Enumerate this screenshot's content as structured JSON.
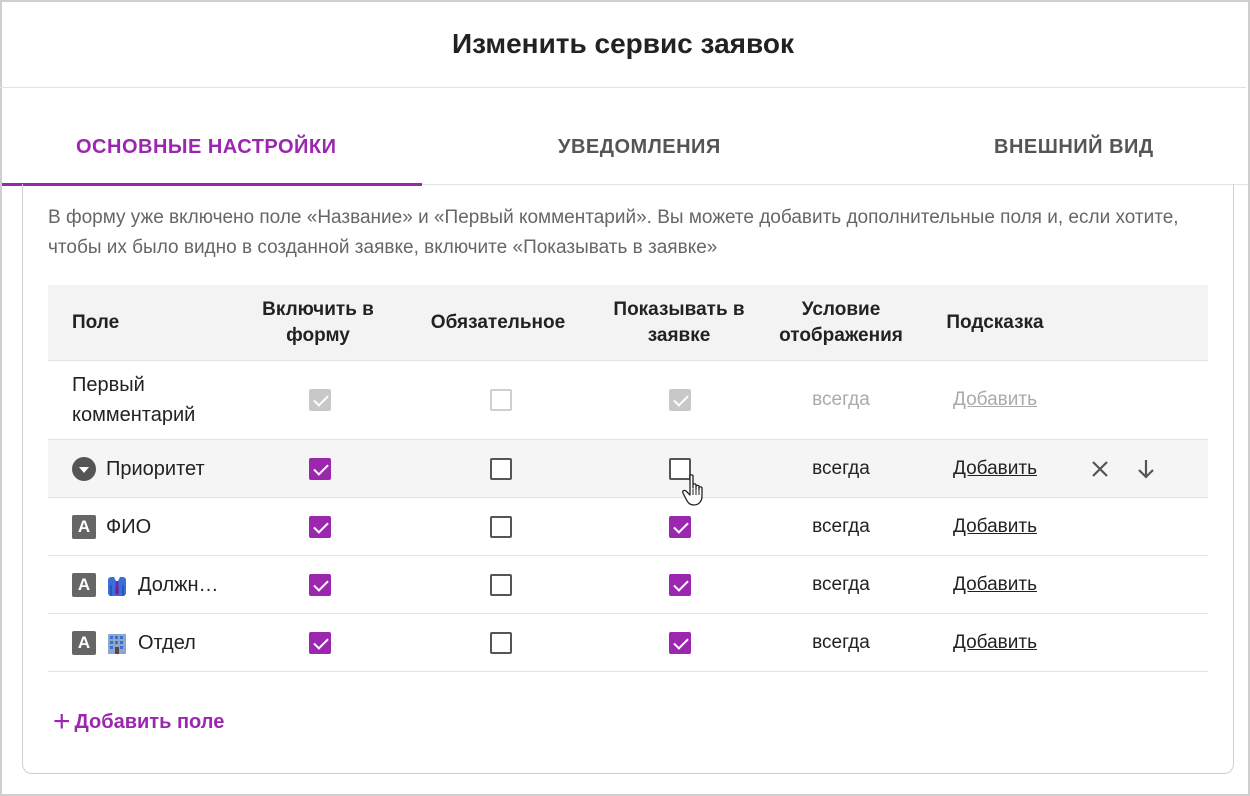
{
  "dialog": {
    "title": "Изменить сервис заявок"
  },
  "tabs": [
    {
      "label": "ОСНОВНЫЕ НАСТРОЙКИ",
      "active": true
    },
    {
      "label": "УВЕДОМЛЕНИЯ",
      "active": false
    },
    {
      "label": "ВНЕШНИЙ ВИД",
      "active": false
    }
  ],
  "intro": "В форму уже включено поле «Название» и «Первый комментарий». Вы можете добавить дополнительные поля и, если хотите, чтобы их было видно в созданной заявке, включите «Показывать в заявке»",
  "table": {
    "headers": {
      "field": "Поле",
      "include": "Включить в форму",
      "required": "Обязательное",
      "show": "Показывать в заявке",
      "condition": "Условие отображения",
      "hint": "Подсказка"
    },
    "rows": [
      {
        "name": "Первый комментарий",
        "icon": "none",
        "include": true,
        "required": false,
        "show": true,
        "condition": "всегда",
        "hint": "Добавить",
        "disabled": true
      },
      {
        "name": "Приоритет",
        "icon": "dropdown-icon",
        "include": true,
        "required": false,
        "show": false,
        "condition": "всегда",
        "hint": "Добавить",
        "disabled": false
      },
      {
        "name": "ФИО",
        "icon": "text-field-icon",
        "include": true,
        "required": false,
        "show": true,
        "condition": "всегда",
        "hint": "Добавить",
        "disabled": false
      },
      {
        "name": "Должн…",
        "icon": "text-field-icon",
        "extra_icon": "suit-emoji-icon",
        "include": true,
        "required": false,
        "show": true,
        "condition": "всегда",
        "hint": "Добавить",
        "disabled": false
      },
      {
        "name": "Отдел",
        "icon": "text-field-icon",
        "extra_icon": "office-building-emoji-icon",
        "include": true,
        "required": false,
        "show": true,
        "condition": "всегда",
        "hint": "Добавить",
        "disabled": false
      }
    ]
  },
  "field_type_icon_letter": "A",
  "add_field": {
    "icon": "+",
    "label": "Добавить поле"
  },
  "colors": {
    "accent": "#9b27af",
    "disabled": "#c8c8c8"
  }
}
